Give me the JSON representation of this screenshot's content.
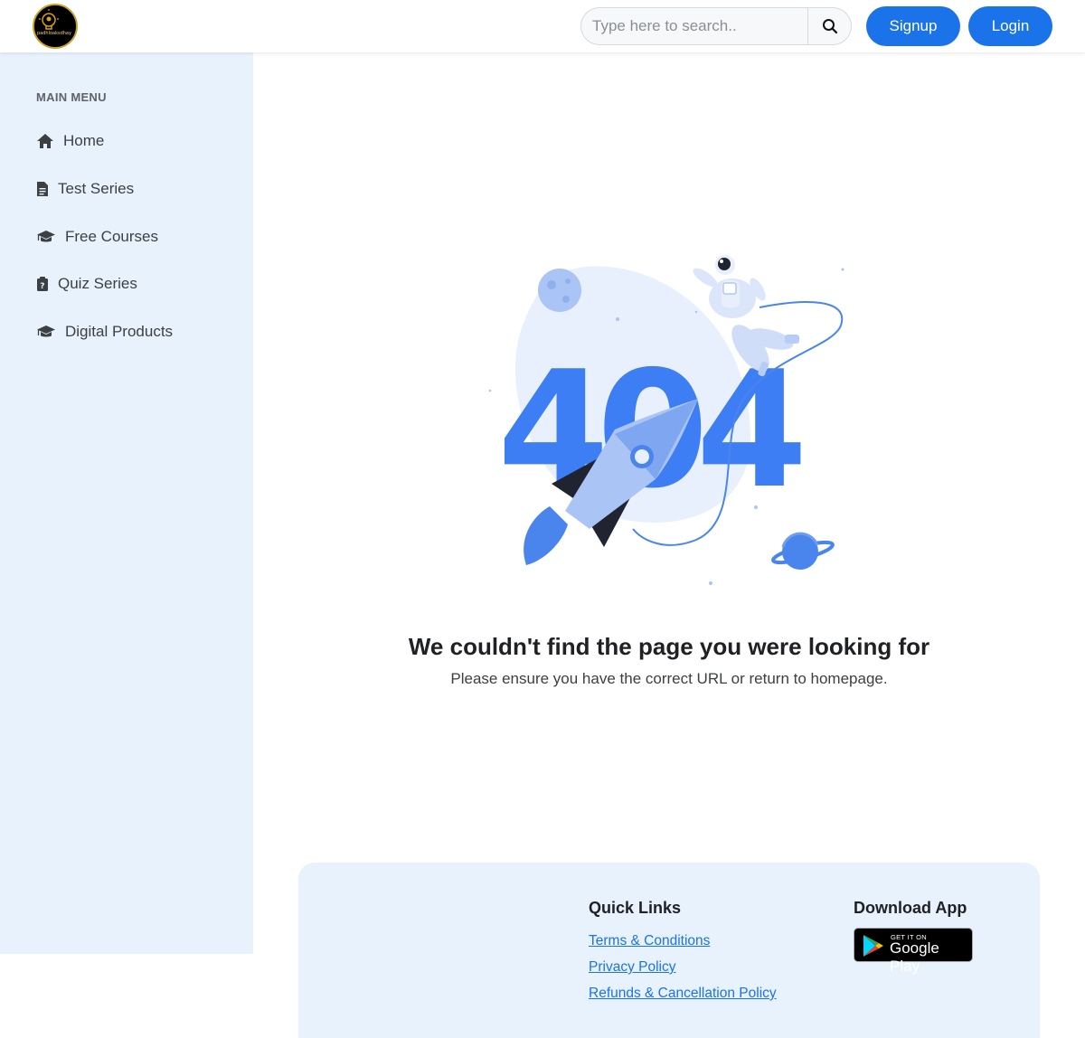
{
  "header": {
    "logo_text": "padhloaksdhay",
    "search_placeholder": "Type here to search..",
    "signup_label": "Signup",
    "login_label": "Login"
  },
  "sidebar": {
    "title": "MAIN MENU",
    "items": [
      {
        "label": "Home",
        "icon": "home-icon"
      },
      {
        "label": "Test Series",
        "icon": "document-icon"
      },
      {
        "label": "Free Courses",
        "icon": "graduation-cap-icon"
      },
      {
        "label": "Quiz Series",
        "icon": "clipboard-question-icon"
      },
      {
        "label": "Digital Products",
        "icon": "graduation-cap-icon"
      }
    ]
  },
  "main": {
    "error_code": "404",
    "heading": "We couldn't find the page you were looking for",
    "subtext": "Please ensure you have the correct URL or return to homepage."
  },
  "footer": {
    "quick_links_title": "Quick Links",
    "links": [
      "Terms & Conditions",
      "Privacy Policy",
      "Refunds & Cancellation Policy"
    ],
    "download_title": "Download App",
    "badge_small": "GET IT ON",
    "badge_big": "Google Play"
  },
  "colors": {
    "accent": "#1a73e8",
    "sidebar_bg": "#e8f2fd",
    "illustration_blue": "#3d7ef5"
  }
}
